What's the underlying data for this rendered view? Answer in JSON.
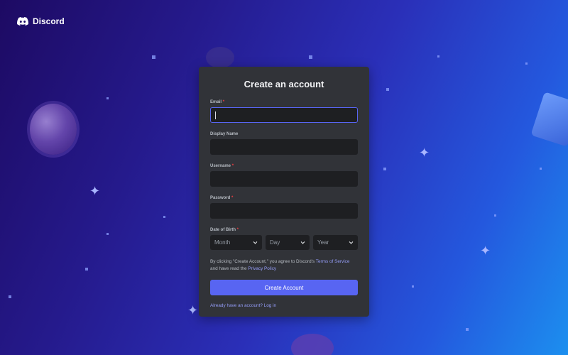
{
  "brand": {
    "logo_text": "Discord"
  },
  "form": {
    "title": "Create an account",
    "email": {
      "label": "Email",
      "required": "*"
    },
    "display_name": {
      "label": "Display Name"
    },
    "username": {
      "label": "Username",
      "required": "*"
    },
    "password": {
      "label": "Password",
      "required": "*"
    },
    "dob": {
      "label": "Date of Birth",
      "required": "*",
      "month": "Month",
      "day": "Day",
      "year": "Year"
    },
    "terms": {
      "prefix": "By clicking \"Create Account,\" you agree to Discord's ",
      "tos_link": "Terms of Service",
      "middle": " and have read the ",
      "privacy_link": "Privacy Policy"
    },
    "submit_label": "Create Account",
    "login_link": "Already have an account? Log in"
  },
  "colors": {
    "accent": "#5865f2",
    "card": "#313338",
    "input": "#1e1f22",
    "link": "#949cf7",
    "required": "#f23f42"
  }
}
